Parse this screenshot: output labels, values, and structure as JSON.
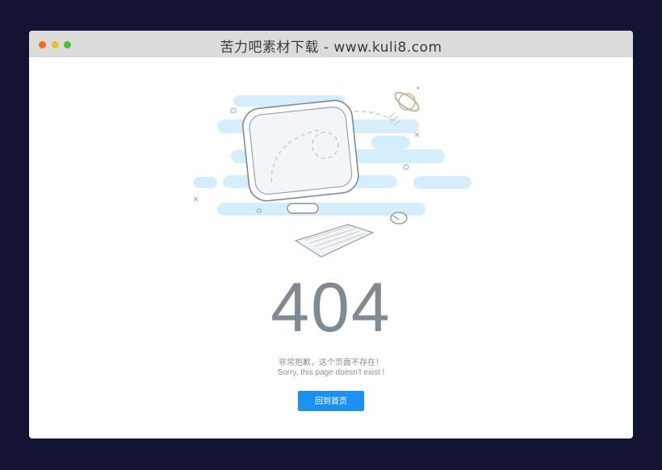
{
  "window": {
    "title": "苦力吧素材下载 - www.kuli8.com"
  },
  "error": {
    "code": "404",
    "message_cn": "非常抱歉，这个页面不存在！",
    "message_en": "Sorry, this page doesn't exist !"
  },
  "actions": {
    "home_label": "回到首页"
  },
  "colors": {
    "page_background": "#121433",
    "titlebar": "#dcdcdc",
    "accent_button": "#1a91f0",
    "code_text": "#7f8a93",
    "cloud_blue": "#d6eefc"
  }
}
